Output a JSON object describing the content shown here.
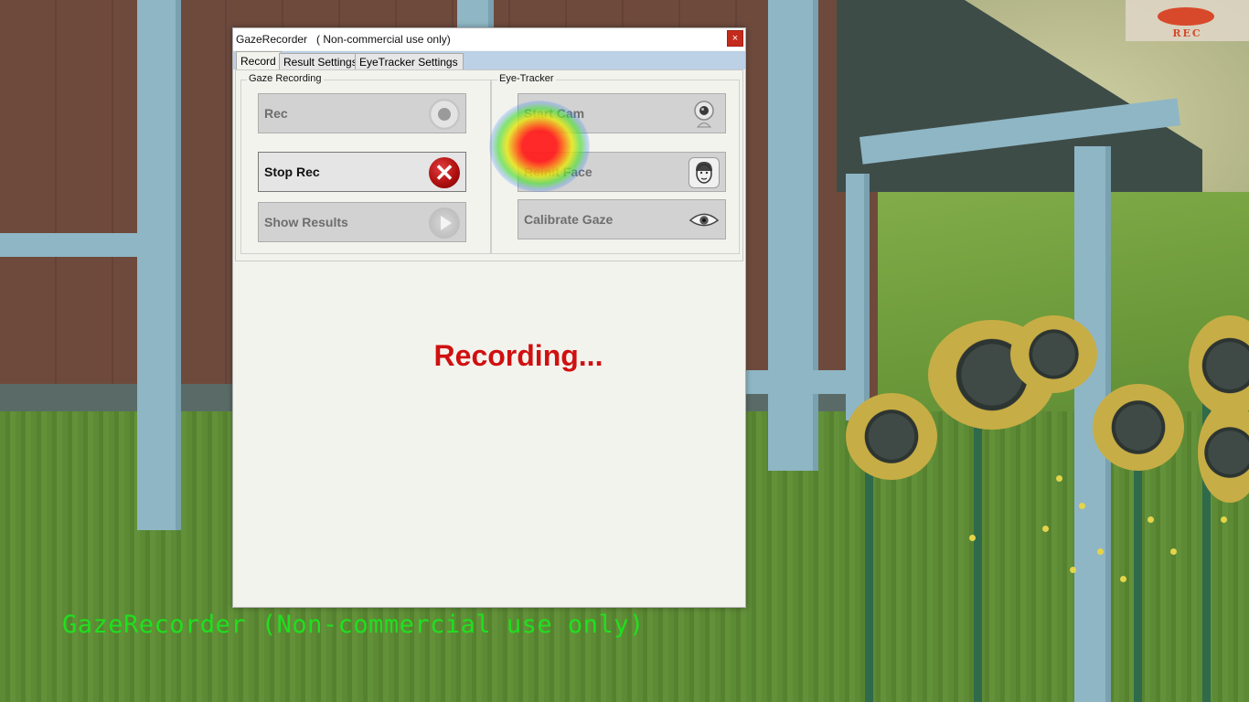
{
  "window": {
    "title": "GazeRecorder   ( Non-commercial use only)",
    "close_glyph": "×"
  },
  "tabs": [
    {
      "label": "Record",
      "active": true
    },
    {
      "label": "Result Settings",
      "active": false
    },
    {
      "label": "EyeTracker Settings",
      "active": false
    }
  ],
  "gaze_recording": {
    "label": "Gaze Recording",
    "buttons": [
      {
        "label": "Rec",
        "icon": "record-icon",
        "enabled": false
      },
      {
        "label": "Stop Rec",
        "icon": "stop-icon",
        "enabled": true
      },
      {
        "label": "Show Results",
        "icon": "play-icon",
        "enabled": false
      }
    ]
  },
  "eye_tracker": {
    "label": "Eye-Tracker",
    "buttons": [
      {
        "label": "Start Cam",
        "icon": "webcam-icon",
        "enabled": false
      },
      {
        "label": "Reinit Face",
        "icon": "face-icon",
        "enabled": false
      },
      {
        "label": "Calibrate Gaze",
        "icon": "eye-icon",
        "enabled": false
      }
    ]
  },
  "status_text": "Recording...",
  "overlay": {
    "rec_badge": "REC",
    "caption": "GazeRecorder (Non-commercial use only)"
  },
  "colors": {
    "status": "#d01010",
    "caption": "#1fe01f",
    "rec_badge": "#d8492b",
    "tab_strip": "#bcd0e6"
  }
}
